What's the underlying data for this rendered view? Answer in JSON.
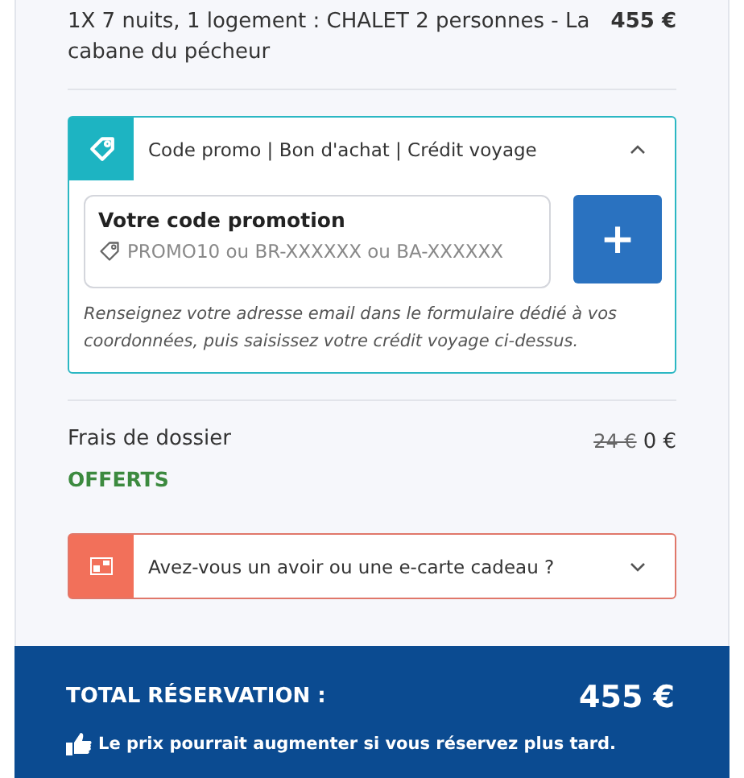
{
  "line_item": {
    "label": "1X 7 nuits, 1 logement : CHALET 2 personnes - La cabane du pécheur",
    "price": "455 €"
  },
  "promo": {
    "title": "Code promo | Bon d'achat | Crédit voyage",
    "expanded": true,
    "field_label": "Votre code promotion",
    "placeholder": "PROMO10 ou BR-XXXXXX ou BA-XXXXXX",
    "add_button": "+",
    "help": "Renseignez votre adresse email dans le formulaire dédié à vos coordonnées, puis saisissez votre crédit voyage ci-dessus."
  },
  "fees": {
    "label": "Frais de dossier",
    "old_price": "24 €",
    "price": "0 €",
    "badge": "OFFERTS"
  },
  "gift": {
    "title": "Avez-vous un avoir ou une e-carte cadeau ?",
    "expanded": false
  },
  "total": {
    "label": "TOTAL RÉSERVATION :",
    "amount": "455 €",
    "note": "Le prix pourrait augmenter si vous réservez plus tard."
  }
}
